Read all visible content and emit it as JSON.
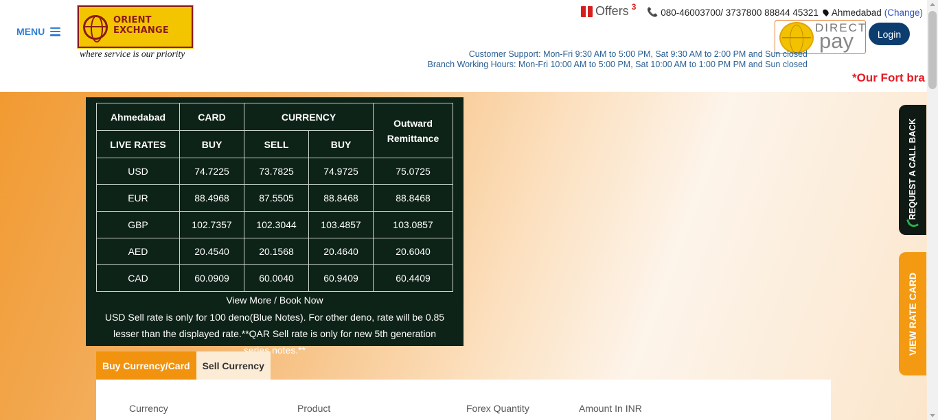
{
  "header": {
    "menu_label": "MENU",
    "logo_line1": "ORIENT",
    "logo_line2": "EXCHANGE",
    "tagline": "where service is our priority",
    "offers_label": "Offers",
    "offers_count": "3",
    "phone": "080-46003700/ 3737800 88844 45321",
    "city": "Ahmedabad",
    "change_label": "(Change)",
    "directpay_line1": "DIRECT",
    "directpay_line2": "pay",
    "login_label": "Login",
    "support_line1": "Customer Support: Mon-Fri 9:30 AM to 5:00 PM, Sat 9:30 AM to 2:00 PM and Sun closed",
    "support_line2": "Branch Working Hours: Mon-Fri 10:00 AM to 5:00 PM, Sat 10:00 AM to 1:00 PM PM and Sun closed",
    "marquee_text": "*Our Fort bra"
  },
  "rates": {
    "city": "Ahmedabad",
    "card_header": "CARD",
    "currency_header": "CURRENCY",
    "outward_header_1": "Outward",
    "outward_header_2": "Remittance",
    "live_rates": "LIVE RATES",
    "card_buy": "BUY",
    "currency_sell": "SELL",
    "currency_buy": "BUY",
    "rows": [
      {
        "code": "USD",
        "card_buy": "74.7225",
        "sell": "73.7825",
        "buy": "74.9725",
        "remit": "75.0725"
      },
      {
        "code": "EUR",
        "card_buy": "88.4968",
        "sell": "87.5505",
        "buy": "88.8468",
        "remit": "88.8468"
      },
      {
        "code": "GBP",
        "card_buy": "102.7357",
        "sell": "102.3044",
        "buy": "103.4857",
        "remit": "103.0857"
      },
      {
        "code": "AED",
        "card_buy": "20.4540",
        "sell": "20.1568",
        "buy": "20.4640",
        "remit": "20.6040"
      },
      {
        "code": "CAD",
        "card_buy": "60.0909",
        "sell": "60.0040",
        "buy": "60.9409",
        "remit": "60.4409"
      }
    ],
    "view_more": "View More / Book Now",
    "note": "USD Sell rate is only for 100 deno(Blue Notes). For other deno, rate will be 0.85 lesser than the displayed rate.**QAR Sell rate is only for new 5th generation series notes.**"
  },
  "tabs": {
    "buy": "Buy Currency/Card",
    "sell": "Sell Currency"
  },
  "form": {
    "currency_label": "Currency",
    "product_label": "Product",
    "quantity_label": "Forex Quantity",
    "amount_label": "Amount In INR"
  },
  "side": {
    "callback_label": "REQUEST A CALL BACK",
    "ratecard_label": "VIEW RATE CARD"
  },
  "colors": {
    "accent_orange": "#f2930f",
    "rate_box_bg": "#0e2318",
    "login_bg": "#0d3d6e",
    "marquee_red": "#e31b23"
  }
}
